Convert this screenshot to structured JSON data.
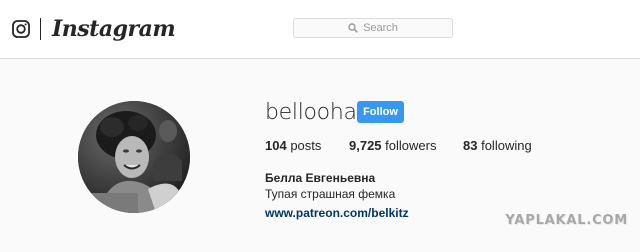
{
  "header": {
    "brand": "Instagram",
    "search_placeholder": "Search"
  },
  "profile": {
    "username": "bellooha",
    "follow_label": "Follow",
    "stats": [
      {
        "count": "104",
        "label": "posts"
      },
      {
        "count": "9,725",
        "label": "followers"
      },
      {
        "count": "83",
        "label": "following"
      }
    ],
    "full_name": "Белла Евгеньевна",
    "bio": "Тупая страшная фемка",
    "website": "www.patreon.com/belkitz"
  },
  "watermark": "YAPLAKAL.COM",
  "icons": {
    "logo": "instagram-glyph-icon",
    "search": "search-icon"
  },
  "colors": {
    "follow_button": "#3897f0",
    "link": "#003569"
  }
}
